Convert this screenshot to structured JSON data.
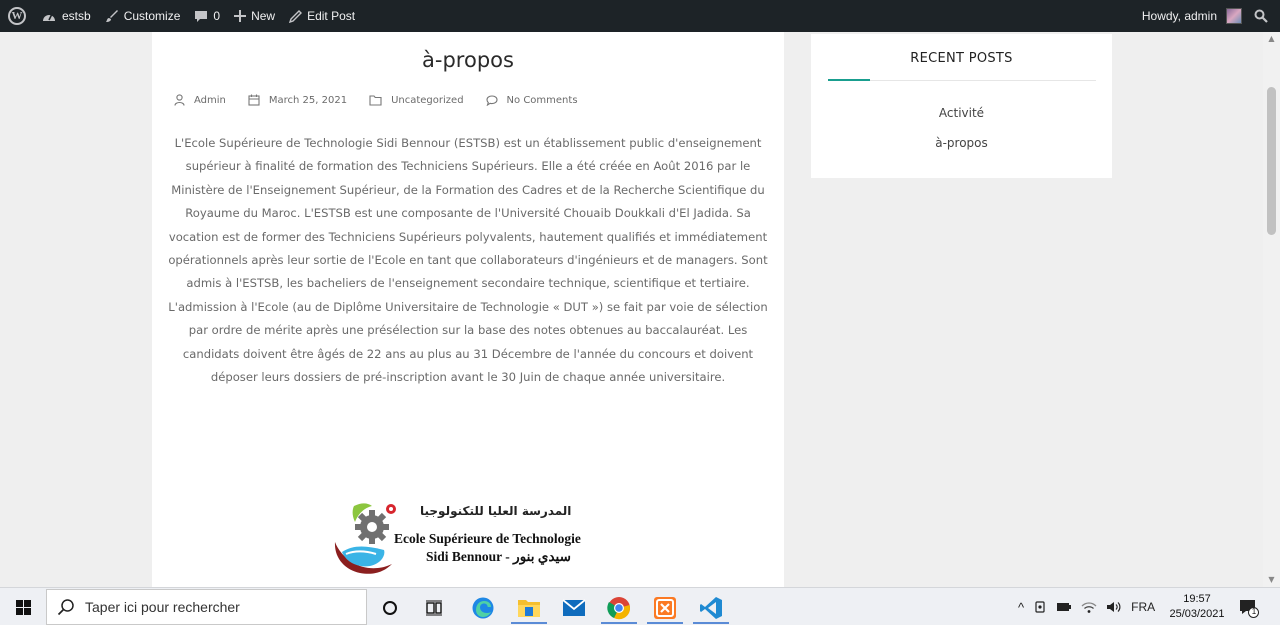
{
  "admin_bar": {
    "site_name": "estsb",
    "customize_label": "Customize",
    "comments_count": "0",
    "new_label": "New",
    "edit_post_label": "Edit Post",
    "greeting": "Howdy, admin"
  },
  "post": {
    "title": "à-propos",
    "author": "Admin",
    "date": "March 25, 2021",
    "category": "Uncategorized",
    "comments": "No Comments",
    "body": "L'Ecole Supérieure de Technologie Sidi Bennour (ESTSB) est un établissement public d'enseignement supérieur à finalité de formation des Techniciens Supérieurs. Elle a été créée en Août 2016 par le Ministère de l'Enseignement Supérieur, de la Formation des Cadres et de la Recherche Scientifique du Royaume du Maroc. L'ESTSB est une composante de l'Université Chouaib Doukkali d'El Jadida. Sa vocation est de former des Techniciens Supérieurs polyvalents, hautement qualifiés et immédiatement opérationnels après leur sortie de l'Ecole en tant que collaborateurs d'ingénieurs et de managers. Sont admis à l'ESTSB, les bacheliers de l'enseignement secondaire technique, scientifique et tertiaire. L'admission à l'Ecole (au de Diplôme Universitaire de Technologie « DUT ») se fait par voie de sélection par ordre de mérite après une présélection sur la base des notes obtenues au baccalauréat. Les candidats doivent être âgés de 22 ans au plus au 31 Décembre de l'année du concours et doivent déposer leurs dossiers de pré-inscription avant le 30 Juin de chaque année universitaire."
  },
  "logo": {
    "arabic_name": "المدرسة العليا للتكنولوجيا",
    "french_name_line1": "Ecole Supérieure de Technologie",
    "french_name_line2": "Sidi Bennour - سيدي بنور"
  },
  "sidebar": {
    "widget_title": "RECENT POSTS",
    "recent_posts": [
      "Activité",
      "à-propos"
    ],
    "accent_color": "#199e8f"
  },
  "taskbar": {
    "search_placeholder": "Taper ici pour rechercher",
    "language": "FRA",
    "time": "19:57",
    "date": "25/03/2021",
    "notification_count": "1",
    "apps": [
      "cortana-icon",
      "task-view-icon",
      "edge-icon",
      "file-explorer-icon",
      "mail-icon",
      "chrome-icon",
      "xampp-icon",
      "vscode-icon"
    ]
  }
}
